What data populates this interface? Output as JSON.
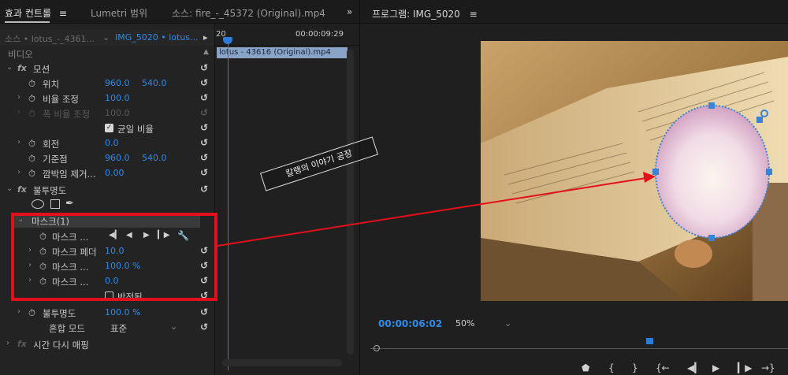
{
  "tabs": {
    "effect_controls": "효과 컨트롤",
    "menu_glyph": "≡",
    "lumetri": "Lumetri 범위",
    "source": "소스: fire_-_45372 (Original).mp4",
    "overflow": "»"
  },
  "source_bar": {
    "source_label": "소스 • lotus_-_4361...",
    "sequence_label": "IMG_5020 • lotus...",
    "play_glyph": "▸",
    "ruler_start": "20",
    "ruler_end": "00:00:09:29"
  },
  "clip": {
    "name": "lotus - 43616 (Original).mp4"
  },
  "effects": {
    "video_header": "비디오",
    "motion": "모션",
    "position": "위치",
    "position_x": "960.0",
    "position_y": "540.0",
    "scale": "비율 조정",
    "scale_val": "100.0",
    "scale_width": "폭 비율 조정",
    "scale_width_val": "100.0",
    "uniform_scale": "균일 비율",
    "rotation": "회전",
    "rotation_val": "0.0",
    "anchor": "기준점",
    "anchor_x": "960.0",
    "anchor_y": "540.0",
    "flicker": "깜박임 제거...",
    "flicker_val": "0.00",
    "opacity": "불투명도",
    "mask": "마스크(1)",
    "mask_path": "마스크 ...",
    "mask_feather": "마스크 페더",
    "mask_feather_val": "10.0",
    "mask_opacity": "마스크 ...",
    "mask_opacity_val": "100.0 %",
    "mask_expansion": "마스크 ...",
    "mask_expansion_val": "0.0",
    "inverted": "반전됨",
    "opacity2": "불투명도",
    "opacity2_val": "100.0 %",
    "blend_mode": "혼합 모드",
    "blend_val": "표준",
    "time_remap": "시간 다시 매핑"
  },
  "program": {
    "title": "프로그램: IMG_5020",
    "menu_glyph": "≡",
    "timecode": "00:00:06:02",
    "zoom": "50%"
  },
  "watermark": "칼랭의 이야기 공장",
  "accent": "#2d8ceb",
  "highlight": "#e2101a"
}
